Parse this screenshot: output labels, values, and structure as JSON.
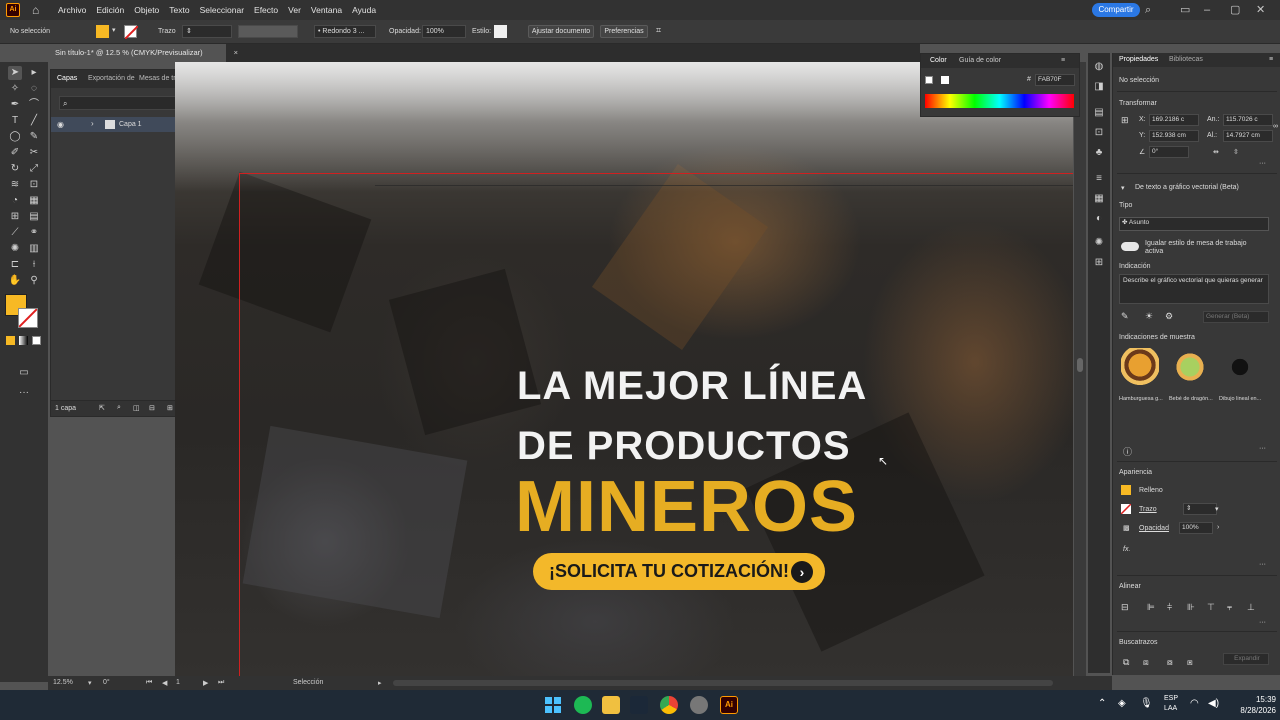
{
  "menubar": {
    "items": [
      "Archivo",
      "Edición",
      "Objeto",
      "Texto",
      "Seleccionar",
      "Efecto",
      "Ver",
      "Ventana",
      "Ayuda"
    ],
    "share_label": "Compartir"
  },
  "control_bar": {
    "selection": "No selección",
    "fill_color": "#F7B924",
    "stroke_label": "Trazo",
    "brush_label": "Redondo 3 ...",
    "opacity_label": "Opacidad:",
    "opacity_value": "100%",
    "style_label": "Estilo:",
    "adjust_doc_label": "Ajustar documento",
    "prefs_label": "Preferencias"
  },
  "document": {
    "tab_title": "Sin título-1* @ 12.5 % (CMYK/Previsualizar)",
    "close": "×"
  },
  "layers_panel": {
    "tabs": [
      "Capas",
      "Exportación de",
      "Mesas de trab"
    ],
    "layer_name": "Capa 1",
    "layer_count": "1 capa"
  },
  "artwork": {
    "line1": "LA MEJOR LÍNEA",
    "line2": "DE PRODUCTOS",
    "line3": "MINEROS",
    "cta": "¡SOLICITA TU COTIZACIÓN!",
    "cta_arrow": "›",
    "accent": "#E6AD22",
    "cta_color": "#F3B82A"
  },
  "color_panel": {
    "tabs": [
      "Color",
      "Guía de color"
    ],
    "hex": "FAB70F"
  },
  "properties": {
    "tabs": [
      "Propiedades",
      "Bibliotecas"
    ],
    "selection": "No selección",
    "transform_title": "Transformar",
    "x_label": "X:",
    "x_value": "169.2186 c",
    "y_label": "Y:",
    "y_value": "152.938 cm",
    "w_label": "An.:",
    "w_value": "115.7026 c",
    "h_label": "Al.:",
    "h_value": "14.7927 cm",
    "angle": "0°",
    "text_to_vector": "De texto a gráfico vectorial (Beta)",
    "type_label": "Tipo",
    "type_value": "Asunto",
    "toggle_label": "Igualar estilo de mesa de trabajo activa",
    "prompt_label": "Indicación",
    "prompt_placeholder": "Describe el gráfico vectorial que quieras generar",
    "generate_label": "Generar (Beta)",
    "samples_label": "Indicaciones de muestra",
    "samples": [
      "Hamburguesa g...",
      "Bebé de dragón...",
      "Dibujo lineal en..."
    ],
    "appearance_title": "Apariencia",
    "fill_label": "Relleno",
    "stroke_label": "Trazo",
    "opacity_label": "Opacidad",
    "opacity_value": "100%",
    "fx_label": "fx.",
    "align_title": "Alinear",
    "pathfinder_title": "Buscatrazos",
    "expand_label": "Expandir"
  },
  "status_bar": {
    "zoom": "12.5%",
    "rotation": "0°",
    "artboard": "1",
    "tool": "Selección"
  },
  "taskbar": {
    "lang1": "ESP",
    "lang2": "LAA",
    "time": "15:39",
    "date": "8/28/2026"
  }
}
